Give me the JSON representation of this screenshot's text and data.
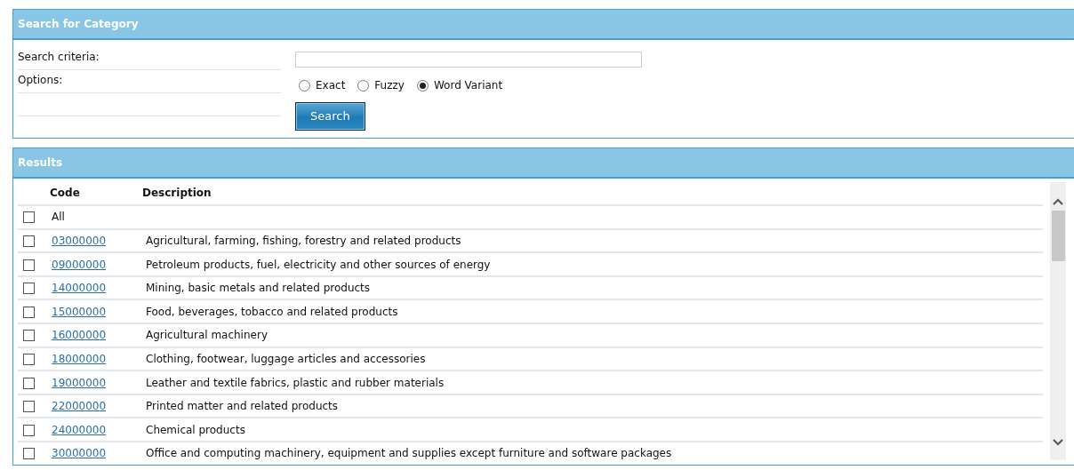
{
  "search_panel": {
    "title": "Search for Category",
    "fields": [
      {
        "label": "Search criteria:"
      },
      {
        "label": "Options:"
      }
    ],
    "options": [
      {
        "label": "Exact",
        "selected": false
      },
      {
        "label": "Fuzzy",
        "selected": false
      },
      {
        "label": "Word Variant",
        "selected": true
      }
    ],
    "button": "Search"
  },
  "results_panel": {
    "title": "Results",
    "columns": [
      "Code",
      "Description"
    ],
    "all_row": {
      "label": "All",
      "checked": false
    },
    "rows": [
      {
        "code": "03000000",
        "description": "Agricultural, farming, fishing, forestry and related products",
        "checked": false
      },
      {
        "code": "09000000",
        "description": "Petroleum products, fuel, electricity and other sources of energy",
        "checked": false
      },
      {
        "code": "14000000",
        "description": "Mining, basic metals and related products",
        "checked": false
      },
      {
        "code": "15000000",
        "description": "Food, beverages, tobacco and related products",
        "checked": false
      },
      {
        "code": "16000000",
        "description": "Agricultural machinery",
        "checked": false
      },
      {
        "code": "18000000",
        "description": "Clothing, footwear, luggage articles and accessories",
        "checked": false
      },
      {
        "code": "19000000",
        "description": "Leather and textile fabrics, plastic and rubber materials",
        "checked": false
      },
      {
        "code": "22000000",
        "description": "Printed matter and related products",
        "checked": false
      },
      {
        "code": "24000000",
        "description": "Chemical products",
        "checked": false
      },
      {
        "code": "30000000",
        "description": "Office and computing machinery, equipment and supplies except furniture and software packages",
        "checked": false
      }
    ]
  }
}
